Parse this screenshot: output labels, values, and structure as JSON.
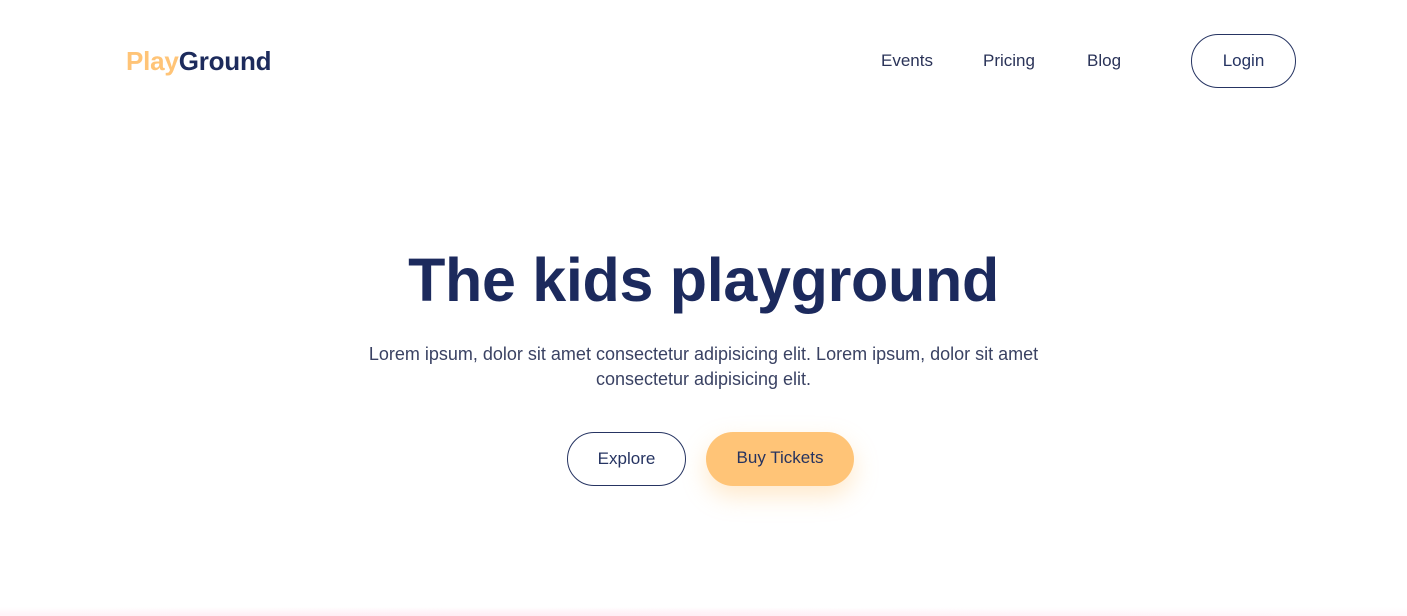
{
  "header": {
    "logo": {
      "part1": "Play",
      "part2": "Ground"
    },
    "nav": {
      "events": "Events",
      "pricing": "Pricing",
      "blog": "Blog"
    },
    "login_label": "Login"
  },
  "hero": {
    "title": "The kids playground",
    "description": "Lorem ipsum, dolor sit amet consectetur adipisicing elit. Lorem ipsum, dolor sit amet consectetur adipisicing elit.",
    "explore_label": "Explore",
    "tickets_label": "Buy Tickets"
  },
  "colors": {
    "brand_primary": "#1c2a5d",
    "brand_accent": "#ffc477",
    "background": "#ffffff"
  }
}
